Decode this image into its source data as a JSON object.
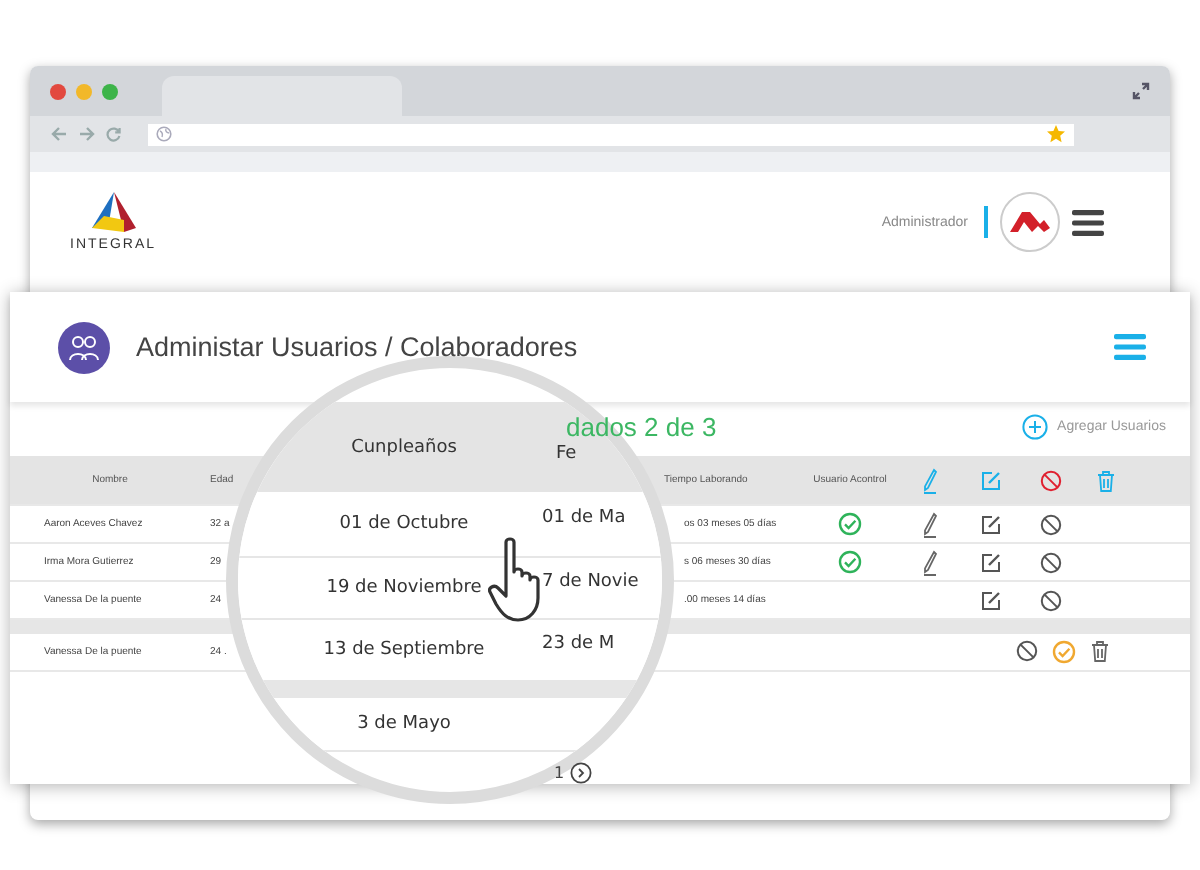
{
  "header": {
    "logo_text": "INTEGRAL",
    "user_role": "Administrador"
  },
  "page_title": "Administar Usuarios / Colaboradores",
  "summary": "dados 2 de 3",
  "add_button": "Agregar Usuarios",
  "columns": [
    {
      "label": "Nombre"
    },
    {
      "label": "Edad"
    },
    {
      "label": "Tiempo Laborando"
    },
    {
      "label": "Usuario Acontrol"
    }
  ],
  "rows": [
    {
      "name": "Aaron Aceves Chavez",
      "age": "32 a",
      "tenure": "os 03 meses 05 días",
      "acontrol": true,
      "signature": true
    },
    {
      "name": "Irma Mora Gutierrez",
      "age": "29",
      "tenure": "s 06 meses 30 días",
      "acontrol": true,
      "signature": true
    },
    {
      "name": "Vanessa De la puente",
      "age": "24",
      "tenure": ".00 meses 14 días",
      "acontrol": false,
      "signature": false
    }
  ],
  "other_rows": [
    {
      "name": "Vanessa De la puente",
      "age": "24 .",
      "actions": [
        {
          "kind": "block"
        },
        {
          "kind": "approve"
        },
        {
          "kind": "delete"
        }
      ]
    }
  ],
  "pagination": {
    "page": "1"
  },
  "magnifier": {
    "columns": [
      "Cunpleaños",
      "Fe"
    ],
    "rows": [
      [
        "01 de Octubre",
        "01 de Ma"
      ],
      [
        "19 de Noviembre",
        "7 de Novie"
      ],
      [
        "13 de Septiembre",
        "23 de M"
      ]
    ],
    "other_rows": [
      [
        "3 de Mayo"
      ]
    ]
  }
}
